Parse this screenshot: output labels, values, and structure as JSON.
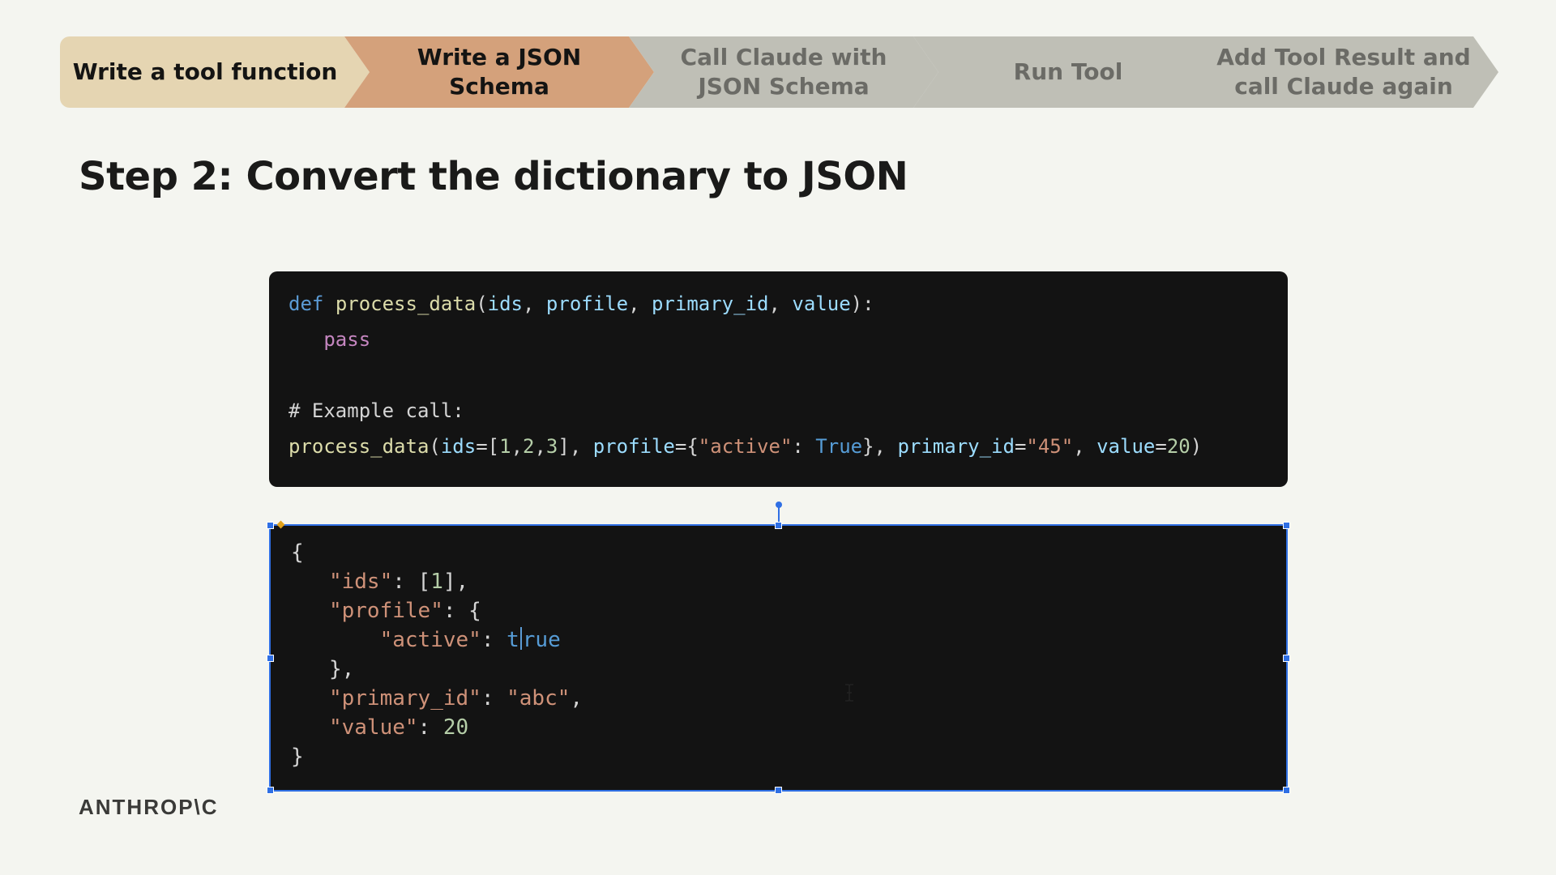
{
  "steps": [
    {
      "line1": "Write a tool function",
      "line2": ""
    },
    {
      "line1": "Write a JSON",
      "line2": "Schema"
    },
    {
      "line1": "Call Claude with",
      "line2": "JSON Schema"
    },
    {
      "line1": "Run Tool",
      "line2": ""
    },
    {
      "line1": "Add Tool Result and",
      "line2": "call Claude again"
    }
  ],
  "title": "Step 2: Convert the dictionary to JSON",
  "python_code": {
    "def": "def",
    "func": "process_data",
    "open": "(",
    "p1": "ids",
    "c1": ", ",
    "p2": "profile",
    "c2": ", ",
    "p3": "primary_id",
    "c3": ", ",
    "p4": "value",
    "close": "):",
    "pass": "pass",
    "comment": "# Example call:",
    "call_fn": "process_data",
    "call_open": "(",
    "a_ids": "ids",
    "eq1": "=[",
    "n1": "1",
    "cm1": ",",
    "n2": "2",
    "cm2": ",",
    "n3": "3",
    "br1": "], ",
    "a_profile": "profile",
    "eq2": "={",
    "s_active": "\"active\"",
    "colon1": ": ",
    "b_true": "True",
    "br2": "}, ",
    "a_pid": "primary_id",
    "eq3": "=",
    "s_45": "\"45\"",
    "cm3": ", ",
    "a_value": "value",
    "eq4": "=",
    "n20": "20",
    "call_close": ")"
  },
  "json_code": {
    "open_brace": "{",
    "k_ids": "\"ids\"",
    "ids_rest_1": ": [",
    "ids_num": "1",
    "ids_rest_2": "],",
    "k_profile": "\"profile\"",
    "profile_rest": ": {",
    "k_active": "\"active\"",
    "active_colon": ": ",
    "true_t": "t",
    "true_rest": "rue",
    "close_inner": "},",
    "k_pid": "\"primary_id\"",
    "pid_colon": ": ",
    "v_pid": "\"abc\"",
    "pid_comma": ",",
    "k_value": "\"value\"",
    "value_colon": ": ",
    "v_value": "20",
    "close_brace": "}"
  },
  "logo": "ANTHROP\\C",
  "colors": {
    "background": "#f4f5f0",
    "step_done": "#e5d5b2",
    "step_active": "#d4a17b",
    "step_pending": "#bfbfb6",
    "code_bg": "#131313",
    "selection": "#2f6fe4"
  }
}
